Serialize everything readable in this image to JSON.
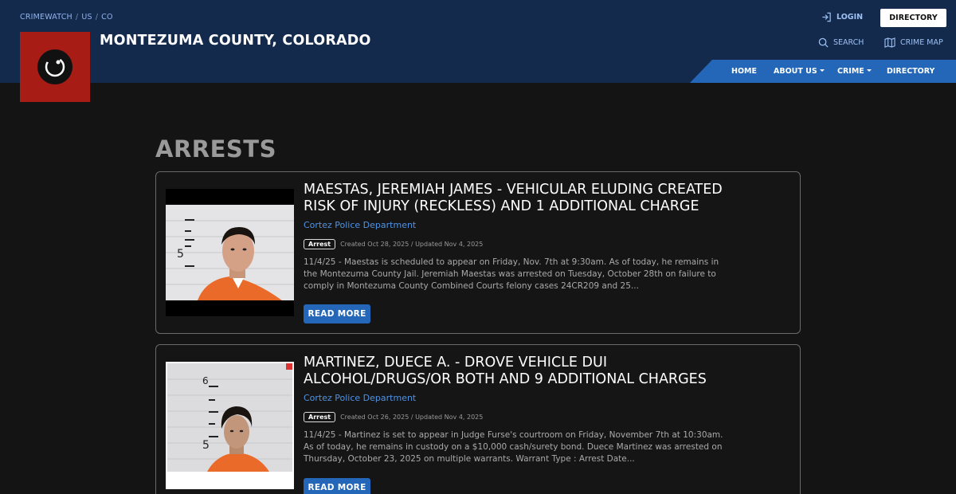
{
  "header": {
    "breadcrumb": [
      "CRIMEWATCH",
      "US",
      "CO"
    ],
    "site_title": "MONTEZUMA COUNTY, COLORADO",
    "login_label": "LOGIN",
    "directory_button": "DIRECTORY",
    "search_label": "SEARCH",
    "crime_map_label": "CRIME MAP"
  },
  "nav": {
    "items": [
      {
        "label": "HOME",
        "dropdown": false
      },
      {
        "label": "ABOUT US",
        "dropdown": true
      },
      {
        "label": "CRIME",
        "dropdown": true
      },
      {
        "label": "DIRECTORY",
        "dropdown": false
      }
    ]
  },
  "main": {
    "page_title": "ARRESTS",
    "cards": [
      {
        "title": "MAESTAS, JEREMIAH JAMES - VEHICULAR ELUDING CREATED RISK OF INJURY (RECKLESS) AND 1 ADDITIONAL CHARGE",
        "department": "Cortez Police Department",
        "badge": "Arrest",
        "dates": "Created Oct 28, 2025 / Updated Nov 4, 2025",
        "summary": "11/4/25 - Maestas is scheduled to appear on Friday, Nov. 7th at 9:30am.  As of today, he remains in the Montezuma County Jail.  Jeremiah Maestas was arrested on Tuesday, October 28th on failure to comply in Montezuma County Combined Courts felony cases 24CR209 and 25...",
        "read_more": "READ MORE"
      },
      {
        "title": "MARTINEZ, DUECE A. - DROVE VEHICLE DUI ALCOHOL/DRUGS/OR BOTH AND 9 ADDITIONAL CHARGES",
        "department": "Cortez Police Department",
        "badge": "Arrest",
        "dates": "Created Oct 26, 2025 / Updated Nov 4, 2025",
        "summary": "11/4/25 - Martinez is set to appear in Judge Furse's courtroom on Friday, November 7th at 10:30am. As of today, he remains in custody on a $10,000 cash/surety bond.  Duece Martinez was arrested on Thursday, October 23, 2025 on multiple warrants. Warrant Type : Arrest Date...",
        "read_more": "READ MORE"
      }
    ]
  },
  "colors": {
    "header_bg": "#142a4d",
    "nav_bg": "#2467b8",
    "logo_bg": "#a71c14",
    "link": "#4f93e6",
    "page_bg": "#141414"
  }
}
